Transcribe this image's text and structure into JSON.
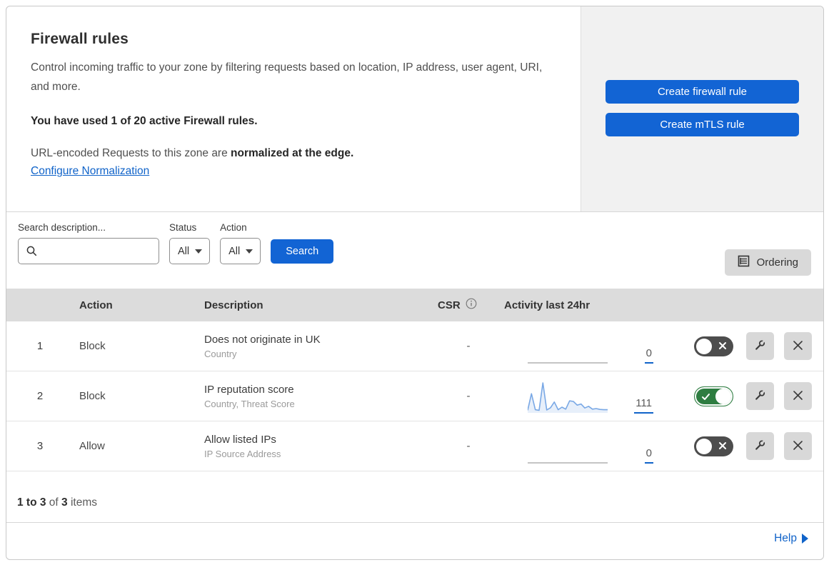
{
  "colors": {
    "accent": "#1264d4",
    "link": "#1063c9",
    "toggle_on": "#2e7d41",
    "toggle_off": "#4d4d4d",
    "sparkline": "#79a8e5",
    "table_header_bg": "#dcdcdc"
  },
  "header": {
    "title": "Firewall rules",
    "description": "Control incoming traffic to your zone by filtering requests based on location, IP address, user agent, URI, and more.",
    "usage_text": "You have used 1 of 20 active Firewall rules.",
    "normalization_prefix": "URL-encoded Requests to this zone are ",
    "normalization_bold": "normalized at the edge.",
    "normalization_link": "Configure Normalization",
    "create_firewall_button": "Create firewall rule",
    "create_mtls_button": "Create mTLS rule"
  },
  "filters": {
    "search_label": "Search description...",
    "status_label": "Status",
    "status_value": "All",
    "action_label": "Action",
    "action_value": "All",
    "search_button": "Search",
    "ordering_button": "Ordering"
  },
  "table": {
    "columns": {
      "action": "Action",
      "description": "Description",
      "csr": "CSR",
      "activity": "Activity last 24hr"
    },
    "rows": [
      {
        "priority": "1",
        "action": "Block",
        "description": "Does not originate in UK",
        "fields": "Country",
        "csr": "-",
        "activity_count": "0",
        "enabled": false,
        "sparkline": []
      },
      {
        "priority": "2",
        "action": "Block",
        "description": "IP reputation score",
        "fields": "Country, Threat Score",
        "csr": "-",
        "activity_count": "111",
        "enabled": true,
        "sparkline": [
          4,
          62,
          6,
          4,
          100,
          5,
          13,
          33,
          6,
          15,
          8,
          37,
          35,
          22,
          26,
          12,
          18,
          8,
          10,
          7,
          6,
          6
        ]
      },
      {
        "priority": "3",
        "action": "Allow",
        "description": "Allow listed IPs",
        "fields": "IP Source Address",
        "csr": "-",
        "activity_count": "0",
        "enabled": false,
        "sparkline": []
      }
    ]
  },
  "footer": {
    "range": "1 to 3",
    "of_text": "of",
    "total": "3",
    "items_text": "items",
    "help_link": "Help"
  }
}
